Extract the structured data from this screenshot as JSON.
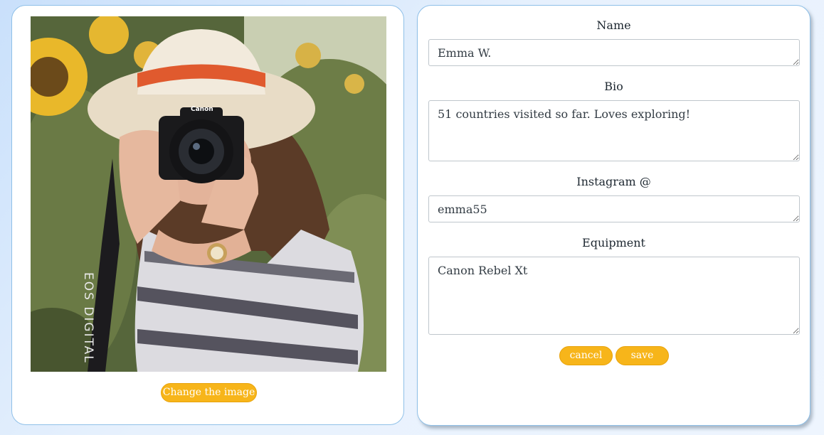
{
  "profile_image": {
    "change_button_label": "Change the image",
    "camera_brand_text": "Canon",
    "strap_text": "EOS DIGITAL"
  },
  "form": {
    "name": {
      "label": "Name",
      "value": "Emma W."
    },
    "bio": {
      "label": "Bio",
      "value": "51 countries visited so far. Loves exploring!"
    },
    "instagram": {
      "label": "Instagram @",
      "value": "emma55"
    },
    "equipment": {
      "label": "Equipment",
      "value": "Canon Rebel Xt"
    },
    "cancel_label": "cancel",
    "save_label": "save"
  },
  "colors": {
    "accent_button": "#f7b51a",
    "card_border": "#8fc0e8"
  }
}
